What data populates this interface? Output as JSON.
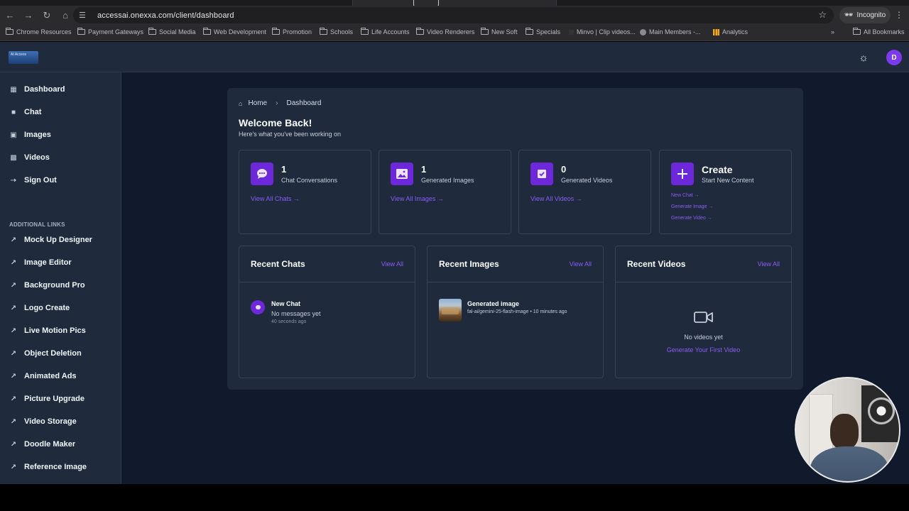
{
  "browser": {
    "url": "accessai.onexxa.com/client/dashboard",
    "incognito_label": "Incognito",
    "bookmarks": [
      {
        "label": "Chrome Resources",
        "type": "folder"
      },
      {
        "label": "Payment Gateways",
        "type": "folder"
      },
      {
        "label": "Social Media",
        "type": "folder"
      },
      {
        "label": "Web Development",
        "type": "folder"
      },
      {
        "label": "Promotion",
        "type": "folder"
      },
      {
        "label": "Schools",
        "type": "folder"
      },
      {
        "label": "Life Accounts",
        "type": "folder"
      },
      {
        "label": "Video Renderers",
        "type": "folder"
      },
      {
        "label": "New Soft",
        "type": "folder"
      },
      {
        "label": "Specials",
        "type": "folder"
      },
      {
        "label": "Minvo | Clip videos...",
        "type": "site"
      },
      {
        "label": "Main Members -...",
        "type": "site"
      },
      {
        "label": "Analytics",
        "type": "site"
      }
    ],
    "more_bookmarks": "»",
    "all_bookmarks": "All Bookmarks"
  },
  "header": {
    "logo_text": "AI Access",
    "avatar_initial": "D"
  },
  "sidebar": {
    "main_items": [
      {
        "label": "Dashboard",
        "icon": "grid-icon"
      },
      {
        "label": "Chat",
        "icon": "chat-icon"
      },
      {
        "label": "Images",
        "icon": "image-icon"
      },
      {
        "label": "Videos",
        "icon": "video-icon"
      },
      {
        "label": "Sign Out",
        "icon": "sign-out-icon"
      }
    ],
    "additional_heading": "ADDITIONAL LINKS",
    "additional_items": [
      "Mock Up Designer",
      "Image Editor",
      "Background Pro",
      "Logo Create",
      "Live Motion Pics",
      "Object Deletion",
      "Animated Ads",
      "Picture Upgrade",
      "Video Storage",
      "Doodle Maker",
      "Reference Image"
    ]
  },
  "breadcrumb": {
    "home": "Home",
    "current": "Dashboard"
  },
  "welcome": {
    "title": "Welcome Back!",
    "subtitle": "Here's what you've been working on"
  },
  "stats": {
    "chats": {
      "count": "1",
      "label": "Chat Conversations",
      "link": "View All Chats →"
    },
    "images": {
      "count": "1",
      "label": "Generated Images",
      "link": "View All Images →"
    },
    "videos": {
      "count": "0",
      "label": "Generated Videos",
      "link": "View All Videos →"
    },
    "create": {
      "title": "Create",
      "label": "Start New Content",
      "links": [
        "New Chat →",
        "Generate Image →",
        "Generate Video →"
      ]
    }
  },
  "recent_chats": {
    "title": "Recent Chats",
    "view_all": "View All",
    "item": {
      "title": "New Chat",
      "subtitle": "No messages yet",
      "time": "40 seconds ago"
    }
  },
  "recent_images": {
    "title": "Recent Images",
    "view_all": "View All",
    "item": {
      "title": "Generated image",
      "meta": "fal-ai/gemini-25-flash-image • 10 minutes ago"
    }
  },
  "recent_videos": {
    "title": "Recent Videos",
    "view_all": "View All",
    "empty_text": "No videos yet",
    "cta": "Generate Your First Video"
  },
  "colors": {
    "accent": "#8b5cf6",
    "badge": "#6d28d9",
    "panel": "#1f2a3c",
    "background": "#111a2c"
  }
}
